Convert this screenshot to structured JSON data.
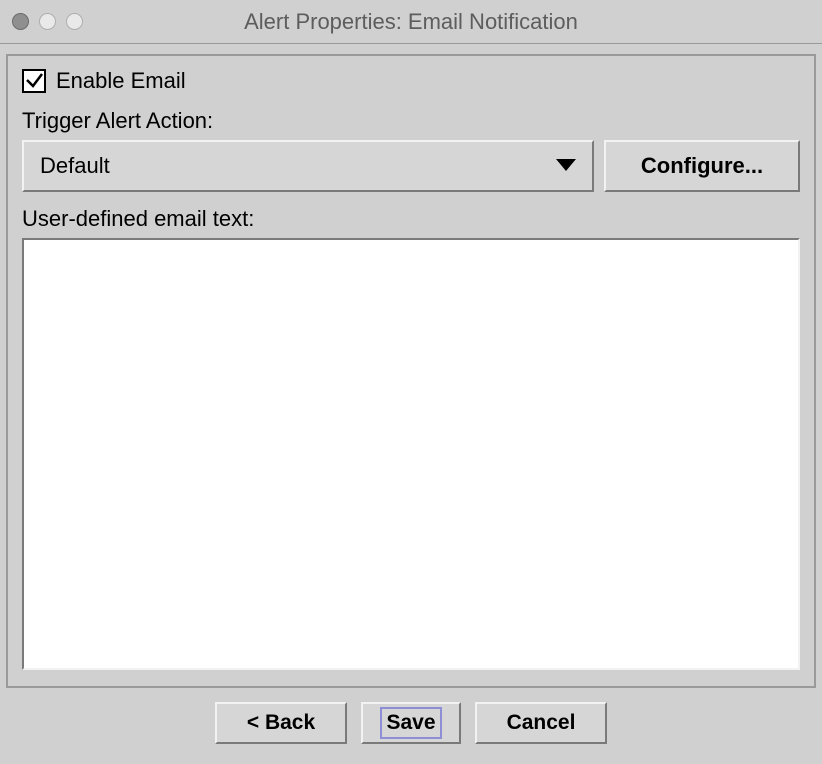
{
  "window": {
    "title": "Alert Properties: Email Notification"
  },
  "panel": {
    "enable_email_label": "Enable Email",
    "enable_email_checked": true,
    "trigger_label": "Trigger Alert Action:",
    "dropdown_value": "Default",
    "configure_label": "Configure...",
    "email_text_label": "User-defined email text:",
    "email_text_value": ""
  },
  "buttons": {
    "back": "< Back",
    "save": "Save",
    "cancel": "Cancel"
  }
}
